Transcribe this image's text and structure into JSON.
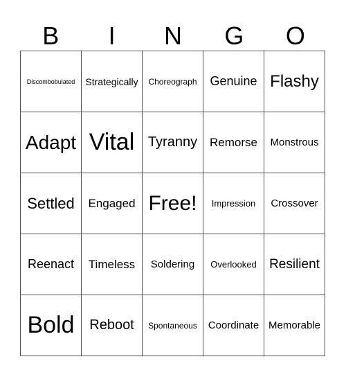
{
  "header": [
    "B",
    "I",
    "N",
    "G",
    "O"
  ],
  "rows": [
    [
      {
        "t": "Discombobulated",
        "s": 9
      },
      {
        "t": "Strategically",
        "s": 14
      },
      {
        "t": "Choreograph",
        "s": 12
      },
      {
        "t": "Genuine",
        "s": 18
      },
      {
        "t": "Flashy",
        "s": 24
      }
    ],
    [
      {
        "t": "Adapt",
        "s": 28
      },
      {
        "t": "Vital",
        "s": 34
      },
      {
        "t": "Tyranny",
        "s": 20
      },
      {
        "t": "Remorse",
        "s": 17
      },
      {
        "t": "Monstrous",
        "s": 15
      }
    ],
    [
      {
        "t": "Settled",
        "s": 22
      },
      {
        "t": "Engaged",
        "s": 17
      },
      {
        "t": "Free!",
        "s": 30
      },
      {
        "t": "Impression",
        "s": 13
      },
      {
        "t": "Crossover",
        "s": 15
      }
    ],
    [
      {
        "t": "Reenact",
        "s": 18
      },
      {
        "t": "Timeless",
        "s": 17
      },
      {
        "t": "Soldering",
        "s": 15
      },
      {
        "t": "Overlooked",
        "s": 13
      },
      {
        "t": "Resilient",
        "s": 19
      }
    ],
    [
      {
        "t": "Bold",
        "s": 34
      },
      {
        "t": "Reboot",
        "s": 20
      },
      {
        "t": "Spontaneous",
        "s": 12
      },
      {
        "t": "Coordinate",
        "s": 15
      },
      {
        "t": "Memorable",
        "s": 15
      }
    ]
  ]
}
